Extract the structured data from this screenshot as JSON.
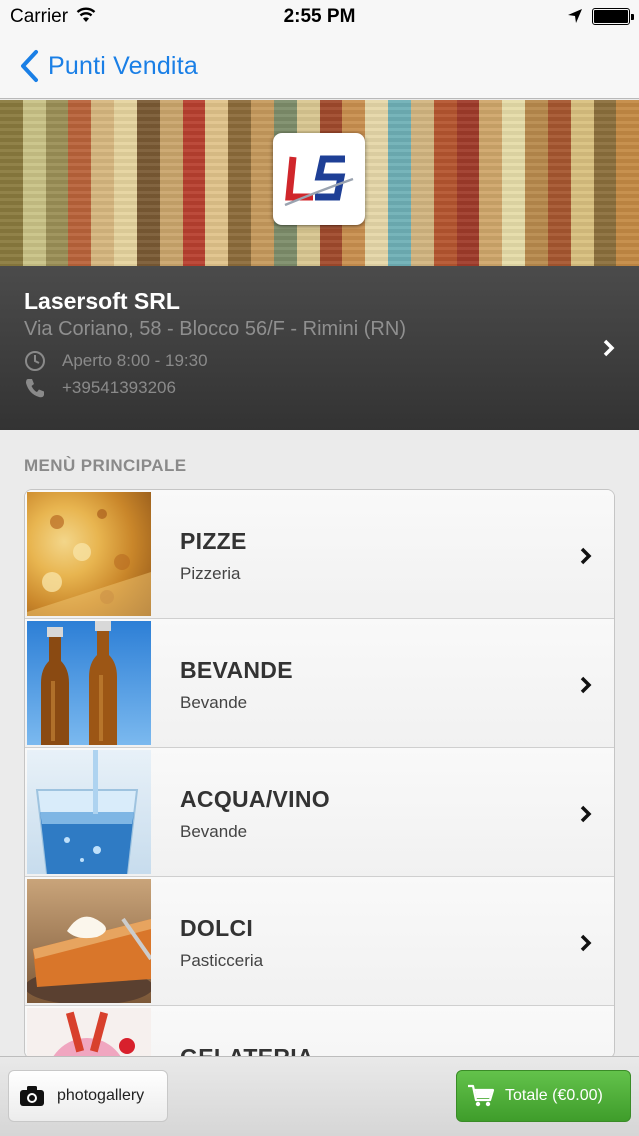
{
  "status_bar": {
    "carrier": "Carrier",
    "time": "2:55 PM"
  },
  "nav": {
    "back_label": "Punti Vendita"
  },
  "store": {
    "name": "Lasersoft SRL",
    "address": "Via Coriano, 58 - Blocco 56/F - Rimini (RN)",
    "hours": "Aperto 8:00 - 19:30",
    "phone": "+39541393206"
  },
  "section": {
    "title": "MENÙ PRINCIPALE"
  },
  "menu": [
    {
      "title": "PIZZE",
      "subtitle": "Pizzeria"
    },
    {
      "title": "BEVANDE",
      "subtitle": "Bevande"
    },
    {
      "title": "ACQUA/VINO",
      "subtitle": "Bevande"
    },
    {
      "title": "DOLCI",
      "subtitle": "Pasticceria"
    },
    {
      "title": "GELATERIA",
      "subtitle": ""
    }
  ],
  "toolbar": {
    "photo_label": "photogallery",
    "total_label": "Totale (€0.00)"
  },
  "colors": {
    "accent": "#1a7fe6",
    "total_button": "#4caf35",
    "store_panel": "#3c3c3c"
  },
  "icons": [
    "wifi-icon",
    "location-arrow-icon",
    "battery-icon",
    "back-chevron-icon",
    "clock-icon",
    "phone-icon",
    "chevron-right-icon",
    "camera-icon",
    "cart-icon"
  ]
}
